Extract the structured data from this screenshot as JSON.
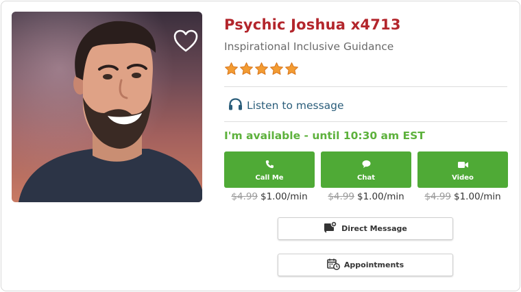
{
  "profile": {
    "name": "Psychic Joshua x4713",
    "tagline": "Inspirational Inclusive Guidance",
    "rating": 5,
    "rating_max": 5,
    "favorite_icon": "heart-outline-icon"
  },
  "listen": {
    "label": "Listen to message",
    "icon": "headphones-icon"
  },
  "availability": {
    "text": "I'm available - until 10:30 am EST"
  },
  "contact_buttons": [
    {
      "label": "Call Me",
      "icon": "phone-icon",
      "old_price": "$4.99",
      "price": "$1.00/min"
    },
    {
      "label": "Chat",
      "icon": "chat-bubble-icon",
      "old_price": "$4.99",
      "price": "$1.00/min"
    },
    {
      "label": "Video",
      "icon": "video-camera-icon",
      "old_price": "$4.99",
      "price": "$1.00/min"
    }
  ],
  "secondary_buttons": {
    "direct_message": {
      "label": "Direct Message",
      "icon": "message-icon"
    },
    "appointments": {
      "label": "Appointments",
      "icon": "calendar-clock-icon"
    }
  },
  "colors": {
    "name": "#b3262c",
    "available": "#5db13c",
    "button_green": "#4faa36",
    "star": "#f39c33",
    "link": "#2a5d7a"
  }
}
